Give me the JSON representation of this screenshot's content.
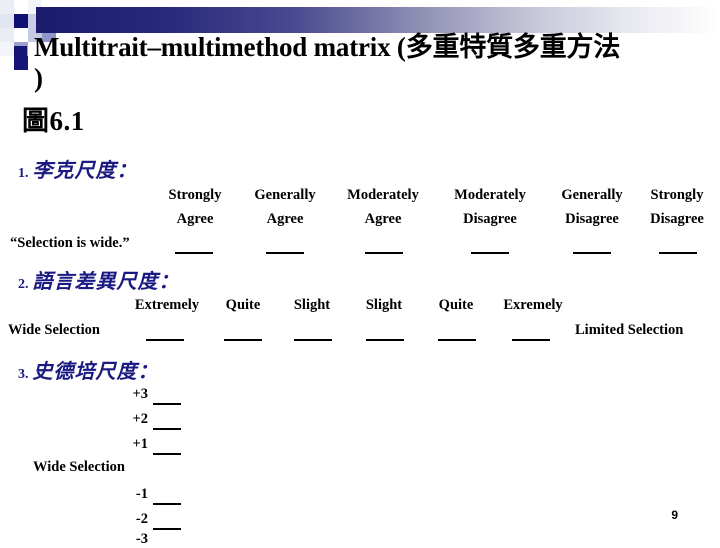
{
  "slide": {
    "title_line1": "Multitrait–multimethod matrix (",
    "title_cjk": "多重特質多重方法",
    "title_line2": ")",
    "subtitle_cjk": "圖",
    "subtitle_num": "6.1",
    "page_number": "9"
  },
  "sections": [
    {
      "number": "1.",
      "heading_cjk": "李克尺度：",
      "row_label": "“Selection is wide.”",
      "columns": [
        {
          "line1": "Strongly",
          "line2": "Agree"
        },
        {
          "line1": "Generally",
          "line2": "Agree"
        },
        {
          "line1": "Moderately",
          "line2": "Agree"
        },
        {
          "line1": "Moderately",
          "line2": "Disagree"
        },
        {
          "line1": "Generally",
          "line2": "Disagree"
        },
        {
          "line1": "Strongly",
          "line2": "Disagree"
        }
      ]
    },
    {
      "number": "2.",
      "heading_cjk": "語言差異尺度：",
      "row_label_left": "Wide Selection",
      "row_label_right": "Limited Selection",
      "columns": [
        {
          "line1": "Extremely"
        },
        {
          "line1": "Quite"
        },
        {
          "line1": "Slight"
        },
        {
          "line1": "Slight"
        },
        {
          "line1": "Quite"
        },
        {
          "line1": "Exremely"
        }
      ]
    },
    {
      "number": "3.",
      "heading_cjk": "史德培尺度：",
      "row_label": "Wide Selection",
      "items": [
        {
          "value": "+3",
          "has_blank": true
        },
        {
          "value": "+2",
          "has_blank": true
        },
        {
          "value": "+1",
          "has_blank": true
        },
        {
          "value": "-1",
          "has_blank": true
        },
        {
          "value": "-2",
          "has_blank": true
        },
        {
          "value": "-3",
          "has_blank": false
        }
      ]
    }
  ]
}
